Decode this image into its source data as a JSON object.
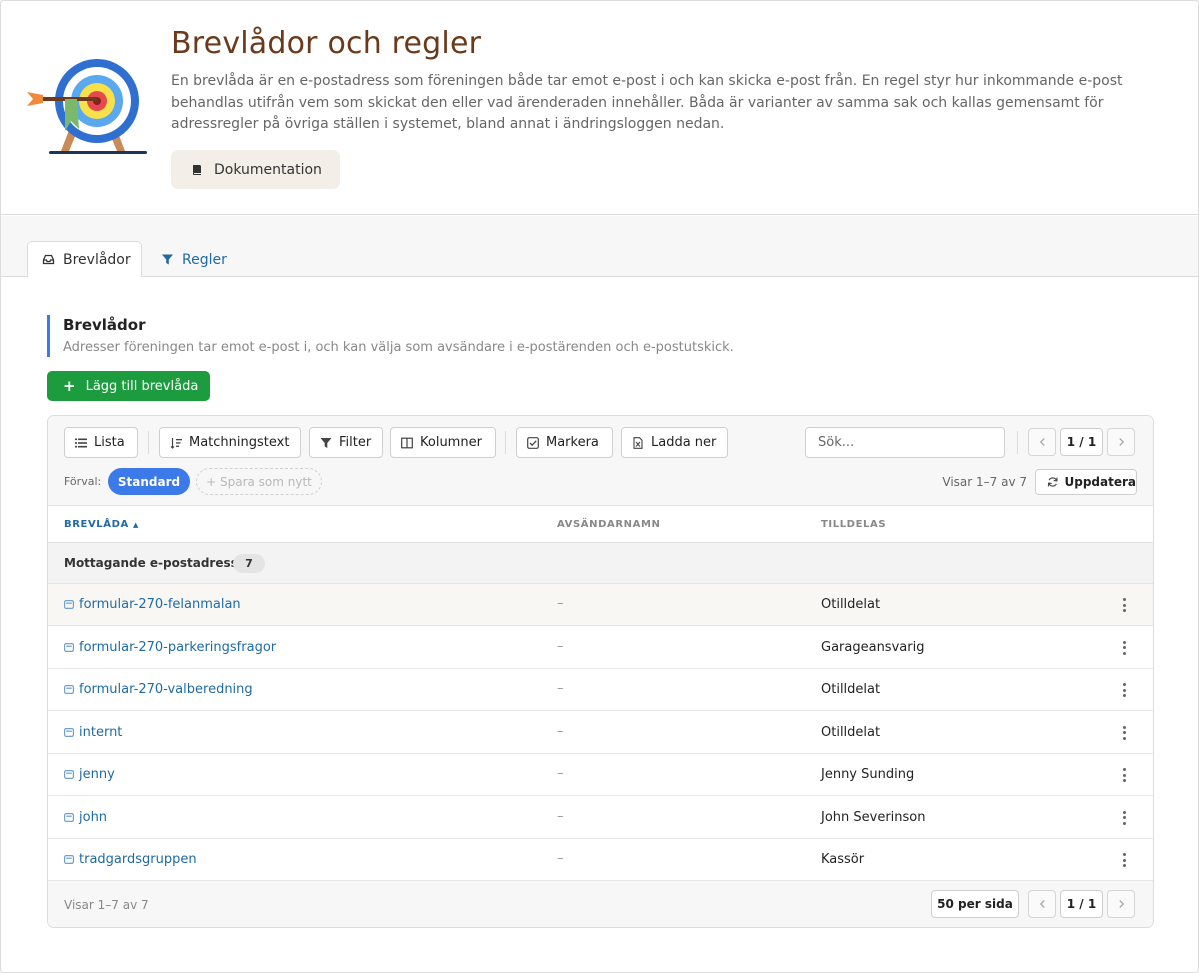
{
  "header": {
    "title": "Brevlådor och regler",
    "description": "En brevlåda är en e-postadress som föreningen både tar emot e-post i och kan skicka e-post från. En regel styr hur inkommande e-post behandlas utifrån vem som skickat den eller vad ärenderaden innehåller. Båda är varianter av samma sak och kallas gemensamt för adressregler på övriga ställen i systemet, bland annat i ändringsloggen nedan.",
    "doc_button": "Dokumentation",
    "icon": "target-icon"
  },
  "tabs": [
    {
      "label": "Brevlådor",
      "icon": "inbox-icon",
      "active": true
    },
    {
      "label": "Regler",
      "icon": "filter-icon",
      "active": false
    }
  ],
  "section": {
    "title": "Brevlådor",
    "subtitle": "Adresser föreningen tar emot e-post i, och kan välja som avsändare i e-postärenden och e-postutskick.",
    "add_button": "Lägg till brevlåda"
  },
  "toolbar": {
    "list": "Lista",
    "matching": "Matchningstext",
    "filter": "Filter",
    "columns": "Kolumner",
    "mark": "Markera",
    "download": "Ladda ner",
    "search_placeholder": "Sök...",
    "page": "1 / 1",
    "preset_label": "Förval:",
    "preset_standard": "Standard",
    "preset_save": "+ Spara som nytt",
    "showing": "Visar 1–7 av 7",
    "refresh": "Uppdatera"
  },
  "table": {
    "columns": [
      "BREVLÅDA",
      "AVSÄNDARNAMN",
      "TILLDELAS"
    ],
    "sort_indicator": "▲",
    "group_label": "Mottagande e-postadress",
    "group_count": "7",
    "rows": [
      {
        "mailbox": "formular-270-felanmalan",
        "sender": "–",
        "assigned": "Otilldelat"
      },
      {
        "mailbox": "formular-270-parkeringsfragor",
        "sender": "–",
        "assigned": "Garageansvarig"
      },
      {
        "mailbox": "formular-270-valberedning",
        "sender": "–",
        "assigned": "Otilldelat"
      },
      {
        "mailbox": "internt",
        "sender": "–",
        "assigned": "Otilldelat"
      },
      {
        "mailbox": "jenny",
        "sender": "–",
        "assigned": "Jenny Sunding"
      },
      {
        "mailbox": "john",
        "sender": "–",
        "assigned": "John Severinson"
      },
      {
        "mailbox": "tradgardsgruppen",
        "sender": "–",
        "assigned": "Kassör"
      }
    ]
  },
  "footer": {
    "showing": "Visar 1–7 av 7",
    "per_page": "50 per sida",
    "page": "1 / 1"
  },
  "colors": {
    "title": "#6b3a1c",
    "accent_blue": "#3b7ae8",
    "link": "#1f6aa3",
    "add_green": "#1d9c3f"
  }
}
